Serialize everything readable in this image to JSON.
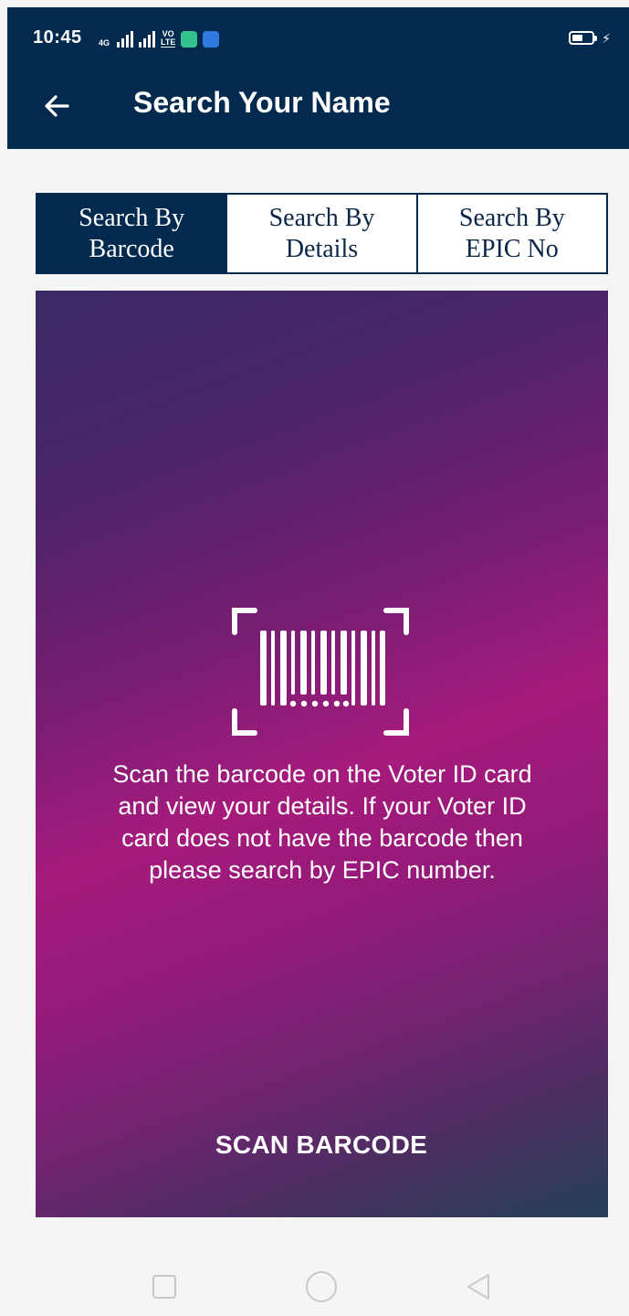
{
  "status_bar": {
    "time": "10:45",
    "network_type": "4G",
    "volte_top": "VO",
    "volte_bottom": "LTE"
  },
  "app_bar": {
    "title": "Search Your Name",
    "background_color": "#022a4f"
  },
  "tabs": [
    {
      "line1": "Search By",
      "line2": "Barcode",
      "active": true
    },
    {
      "line1": "Search By",
      "line2": "Details",
      "active": false
    },
    {
      "line1": "Search By",
      "line2": "EPIC No",
      "active": false
    }
  ],
  "scan_panel": {
    "instructions": "Scan the barcode on the Voter ID card and view your details. If your Voter ID card does not have the barcode then please search by EPIC number.",
    "button_label": "SCAN BARCODE",
    "icon": "barcode-scan-icon"
  },
  "nav_bar": {
    "icons": [
      "recent-apps-icon",
      "home-icon",
      "back-triangle-icon"
    ]
  }
}
